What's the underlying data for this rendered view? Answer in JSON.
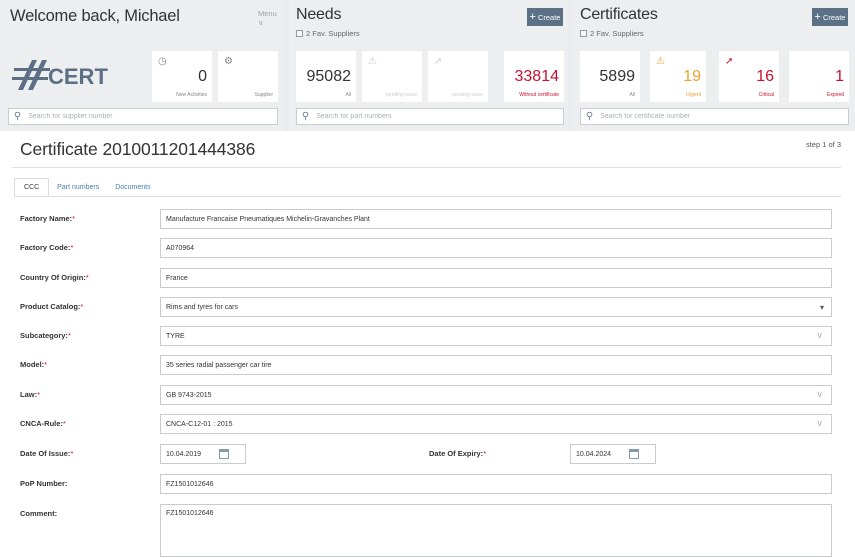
{
  "welcome": {
    "title": "Welcome back, Michael",
    "menu_label": "Menu ∨",
    "logo_text": "CERT",
    "tiles": [
      {
        "value": "0",
        "caption": "New Activities",
        "icon": "clock-icon"
      },
      {
        "value": "",
        "caption": "Supplier",
        "icon": "supplier-icon"
      }
    ],
    "search_placeholder": "Search for supplier number"
  },
  "needs": {
    "title": "Needs",
    "fav": "2 Fav. Suppliers",
    "create_label": "Create",
    "tiles": [
      {
        "value": "95082",
        "caption": "All"
      },
      {
        "value": "",
        "caption": "pending issue",
        "icon": "warning-icon"
      },
      {
        "value": "",
        "caption": "pending issue",
        "icon": "bolt-icon"
      },
      {
        "value": "33814",
        "caption": "Without certificate"
      }
    ],
    "search_placeholder": "Search for part numbers"
  },
  "certificates": {
    "title": "Certificates",
    "fav": "2 Fav. Suppliers",
    "create_label": "Create",
    "tiles": [
      {
        "value": "5899",
        "caption": "All"
      },
      {
        "value": "19",
        "caption": "Urgent",
        "icon": "warning-icon"
      },
      {
        "value": "16",
        "caption": "Critical",
        "icon": "bolt-icon"
      },
      {
        "value": "1",
        "caption": "Expired"
      }
    ],
    "search_placeholder": "Search for certificate number"
  },
  "main": {
    "title": "Certificate 2010011201444386",
    "step": "step 1 of 3",
    "tabs": [
      {
        "label": "CCC"
      },
      {
        "label": "Part numbers"
      },
      {
        "label": "Documents"
      }
    ]
  },
  "form": {
    "factory_name": {
      "label": "Factory Name:",
      "value": "Manufacture Francaise Pneumatiques Michelin-Gravanches Plant"
    },
    "factory_code": {
      "label": "Factory Code:",
      "value": "A070964"
    },
    "country": {
      "label": "Country Of Origin:",
      "value": "France"
    },
    "product_catalog": {
      "label": "Product Catalog:",
      "value": "Rims and tyres for cars"
    },
    "subcategory": {
      "label": "Subcategory:",
      "value": "TYRE"
    },
    "model": {
      "label": "Model:",
      "value": "35 series radial passenger car tire"
    },
    "law": {
      "label": "Law:",
      "value": "GB 9743-2015"
    },
    "cnca_rule": {
      "label": "CNCA-Rule:",
      "value": "CNCA-C12-01 : 2015"
    },
    "date_issue": {
      "label": "Date Of Issue:",
      "value": "10.04.2019"
    },
    "date_expiry": {
      "label": "Date Of Expiry:",
      "value": "10.04.2024"
    },
    "pop_number": {
      "label": "PoP Number:",
      "value": "FZ1501012646"
    },
    "comment": {
      "label": "Comment:",
      "value": "FZ1501012646"
    },
    "required_mark": "*"
  },
  "colors": {
    "accent_blue": "#5c7186",
    "critical_red": "#c8102e",
    "urgent_orange": "#f0a030",
    "link_blue": "#4a7fb5"
  }
}
